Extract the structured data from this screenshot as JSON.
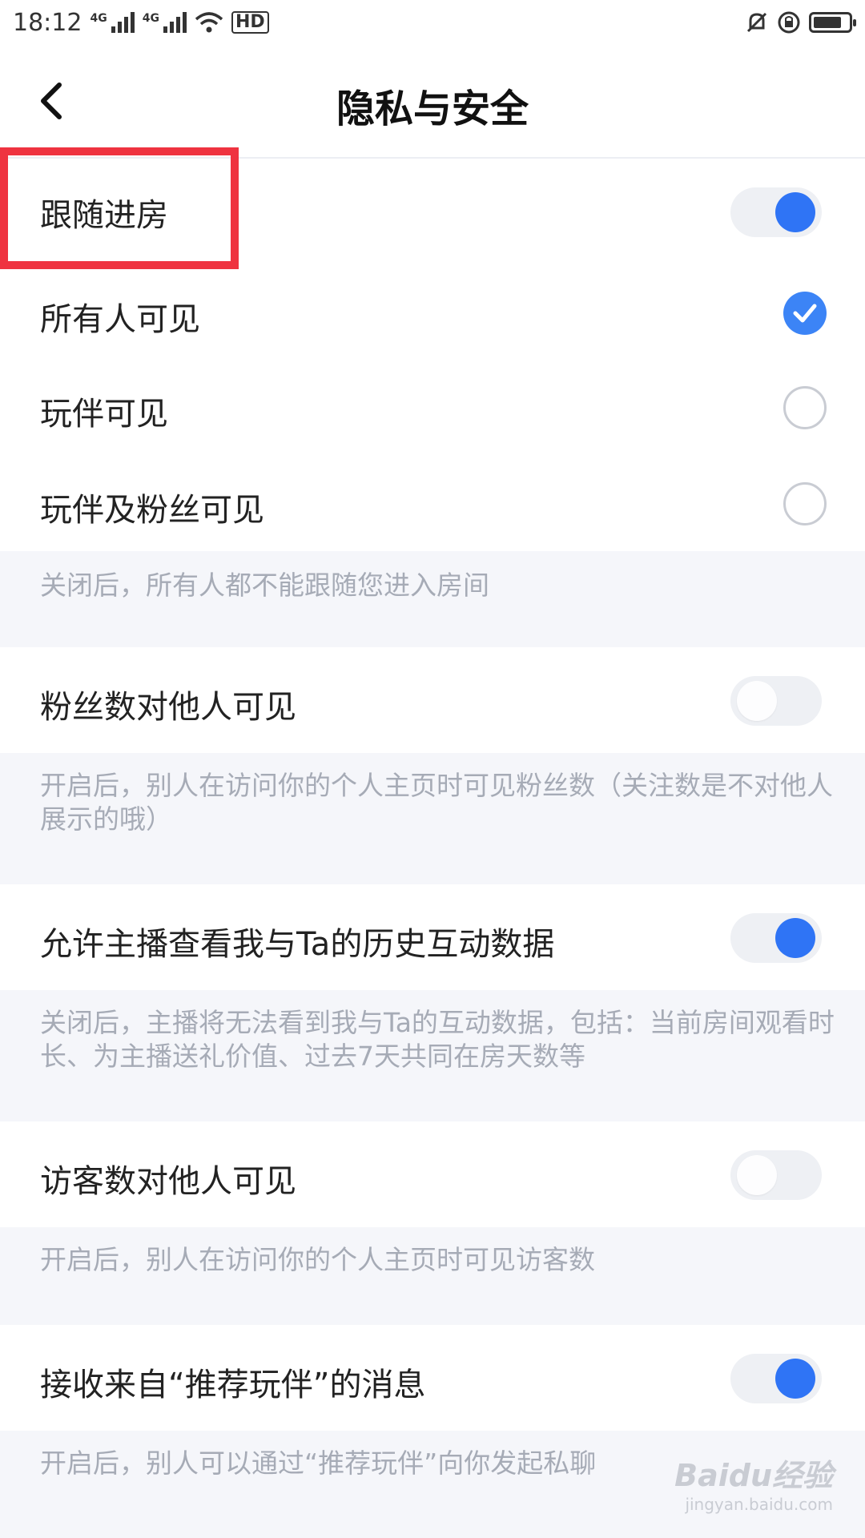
{
  "status_bar": {
    "time": "18:12",
    "network_labels": [
      "4G",
      "4G"
    ],
    "hd_label": "HD",
    "battery_level": 0.8
  },
  "header": {
    "title": "隐私与安全",
    "back_icon": "chevron-left-icon"
  },
  "follow_room": {
    "label": "跟随进房",
    "enabled": true,
    "options": [
      {
        "label": "所有人可见",
        "selected": true
      },
      {
        "label": "玩伴可见",
        "selected": false
      },
      {
        "label": "玩伴及粉丝可见",
        "selected": false
      }
    ],
    "note": "关闭后，所有人都不能跟随您进入房间"
  },
  "settings": [
    {
      "label": "粉丝数对他人可见",
      "enabled": false,
      "note": "开启后，别人在访问你的个人主页时可见粉丝数（关注数是不对他人展示的哦）"
    },
    {
      "label": "允许主播查看我与Ta的历史互动数据",
      "enabled": true,
      "note": "关闭后，主播将无法看到我与Ta的互动数据，包括：当前房间观看时长、为主播送礼价值、过去7天共同在房天数等"
    },
    {
      "label": "访客数对他人可见",
      "enabled": false,
      "note": "开启后，别人在访问你的个人主页时可见访客数"
    },
    {
      "label": "接收来自“推荐玩伴”的消息",
      "enabled": true,
      "note": "开启后，别人可以通过“推荐玩伴”向你发起私聊"
    }
  ],
  "colors": {
    "accent": "#2f74f5",
    "highlight": "#ef3340"
  },
  "watermark": {
    "main": "Baidu经验",
    "sub": "jingyan.baidu.com"
  }
}
